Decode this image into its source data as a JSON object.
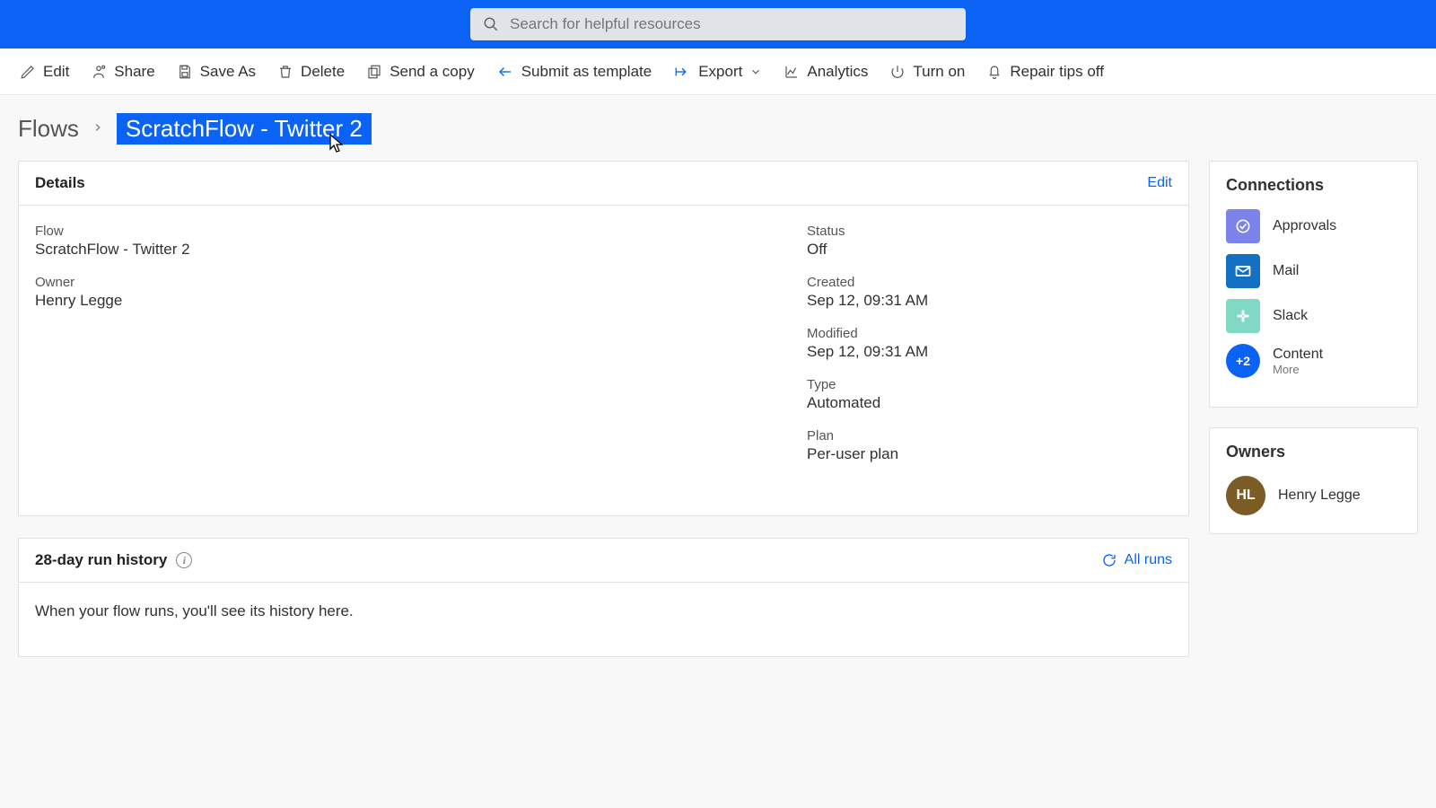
{
  "search": {
    "placeholder": "Search for helpful resources"
  },
  "cmdbar": {
    "edit": "Edit",
    "share": "Share",
    "saveas": "Save As",
    "delete": "Delete",
    "sendcopy": "Send a copy",
    "submit": "Submit as template",
    "export": "Export",
    "analytics": "Analytics",
    "turnon": "Turn on",
    "repair": "Repair tips off"
  },
  "breadcrumb": {
    "root": "Flows",
    "current": "ScratchFlow - Twitter 2"
  },
  "details": {
    "panel_title": "Details",
    "edit_label": "Edit",
    "flow_label": "Flow",
    "flow_value": "ScratchFlow - Twitter 2",
    "owner_label": "Owner",
    "owner_value": "Henry Legge",
    "status_label": "Status",
    "status_value": "Off",
    "created_label": "Created",
    "created_value": "Sep 12, 09:31 AM",
    "modified_label": "Modified",
    "modified_value": "Sep 12, 09:31 AM",
    "type_label": "Type",
    "type_value": "Automated",
    "plan_label": "Plan",
    "plan_value": "Per-user plan"
  },
  "runhistory": {
    "title": "28-day run history",
    "allruns": "All runs",
    "empty_text": "When your flow runs, you'll see its history here."
  },
  "connections": {
    "title": "Connections",
    "items": [
      {
        "label": "Approvals",
        "color": "#7b83eb"
      },
      {
        "label": "Mail",
        "color": "#1370c3"
      },
      {
        "label": "Slack",
        "color": "#7fd9c4"
      }
    ],
    "more": {
      "badge": "+2",
      "label": "Content",
      "sub": "More"
    }
  },
  "owners": {
    "title": "Owners",
    "initials": "HL",
    "name": "Henry Legge"
  }
}
